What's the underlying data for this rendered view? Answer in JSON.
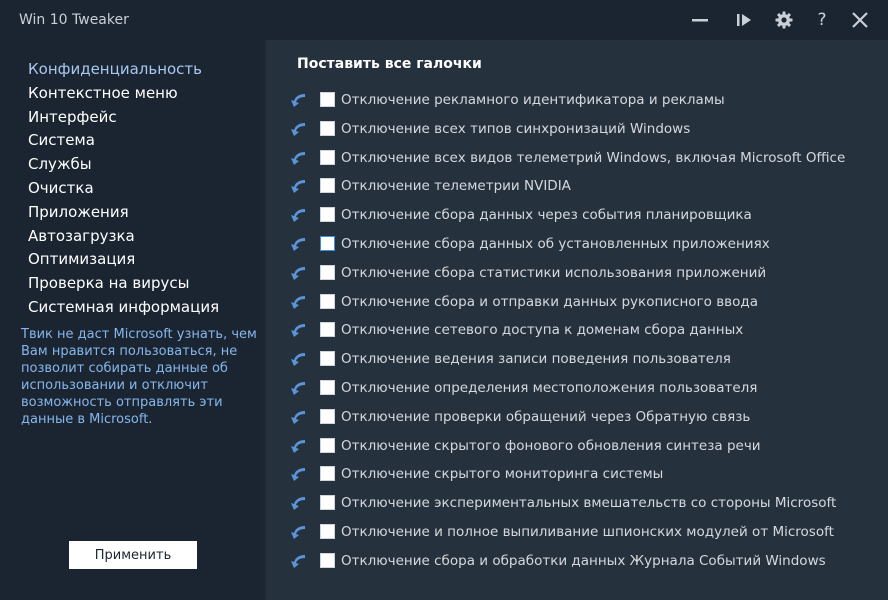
{
  "window": {
    "title": "Win 10 Tweaker",
    "controls": [
      "minimize-icon",
      "play-icon",
      "gear-icon",
      "help-icon",
      "close-icon"
    ],
    "help_glyph": "?"
  },
  "sidebar": {
    "items": [
      {
        "label": "Конфиденциальность",
        "active": true
      },
      {
        "label": "Контекстное меню"
      },
      {
        "label": "Интерфейс"
      },
      {
        "label": "Система"
      },
      {
        "label": "Службы"
      },
      {
        "label": "Очистка"
      },
      {
        "label": "Приложения"
      },
      {
        "label": "Автозагрузка"
      },
      {
        "label": "Оптимизация"
      },
      {
        "label": "Проверка на вирусы"
      },
      {
        "label": "Системная информация"
      }
    ],
    "description": "Твик не даст Microsoft узнать, чем Вам нравится пользоваться, не позволит собирать данные об использовании и отключит возможность отправлять эти данные в Microsoft.",
    "apply_label": "Применить"
  },
  "main": {
    "select_all_label": "Поставить все галочки",
    "options": [
      {
        "label": "Отключение рекламного идентификатора и рекламы",
        "checked": false
      },
      {
        "label": "Отключение всех типов синхронизаций Windows",
        "checked": false
      },
      {
        "label": "Отключение всех видов телеметрий Windows, включая Microsoft Office",
        "checked": false
      },
      {
        "label": "Отключение телеметрии NVIDIA",
        "checked": false
      },
      {
        "label": "Отключение сбора данных через события планировщика",
        "checked": false
      },
      {
        "label": "Отключение сбора данных об установленных приложениях",
        "checked": false,
        "focused": true
      },
      {
        "label": "Отключение сбора статистики использования приложений",
        "checked": false
      },
      {
        "label": "Отключение сбора и отправки данных рукописного ввода",
        "checked": false
      },
      {
        "label": "Отключение сетевого доступа к доменам сбора данных",
        "checked": false
      },
      {
        "label": "Отключение ведения записи поведения пользователя",
        "checked": false
      },
      {
        "label": "Отключение определения местоположения пользователя",
        "checked": false
      },
      {
        "label": "Отключение проверки обращений через Обратную связь",
        "checked": false
      },
      {
        "label": "Отключение скрытого фонового обновления синтеза речи",
        "checked": false
      },
      {
        "label": "Отключение скрытого мониторинга системы",
        "checked": false
      },
      {
        "label": "Отключение экспериментальных вмешательств со стороны Microsoft",
        "checked": false
      },
      {
        "label": "Отключение и полное выпиливание шпионских модулей от Microsoft",
        "checked": false
      },
      {
        "label": "Отключение сбора и обработки данных Журнала Событий Windows",
        "checked": false
      }
    ],
    "row_icon": "info-arrow-icon"
  },
  "colors": {
    "sidebar_bg": "#1b2531",
    "main_bg": "#26313e",
    "accent_text": "#86b6ec",
    "active_nav": "#a8c8f0",
    "info_icon": "#5b95d6"
  }
}
